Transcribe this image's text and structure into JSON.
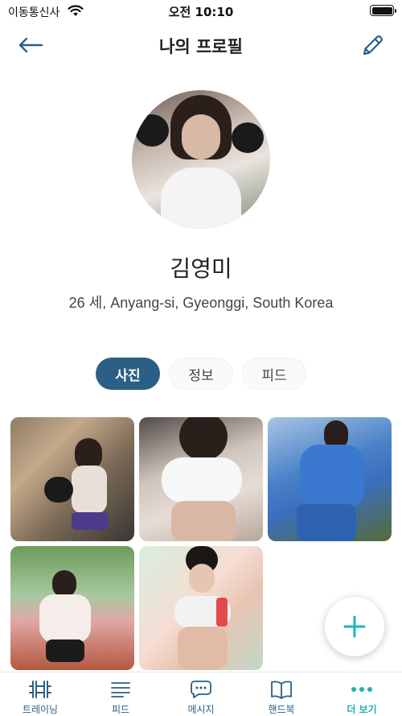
{
  "status_bar": {
    "carrier": "이동통신사",
    "time": "오전 10:10"
  },
  "header": {
    "title": "나의 프로필",
    "back_icon": "arrow-left-icon",
    "edit_icon": "pencil-icon"
  },
  "profile": {
    "name": "김영미",
    "info": "26 세, Anyang-si, Gyeonggi, South Korea"
  },
  "tabs": [
    {
      "label": "사진",
      "selected": true
    },
    {
      "label": "정보",
      "selected": false
    },
    {
      "label": "피드",
      "selected": false
    }
  ],
  "bottom_nav": [
    {
      "label": "트레이닝",
      "icon": "barbell-icon",
      "active": false
    },
    {
      "label": "피드",
      "icon": "feed-lines-icon",
      "active": false
    },
    {
      "label": "메시지",
      "icon": "chat-bubble-icon",
      "active": false
    },
    {
      "label": "핸드북",
      "icon": "book-icon",
      "active": false
    },
    {
      "label": "더 보기",
      "icon": "more-dots-icon",
      "active": true
    }
  ],
  "colors": {
    "primary": "#2b5f85",
    "accent": "#1fb3b3"
  }
}
